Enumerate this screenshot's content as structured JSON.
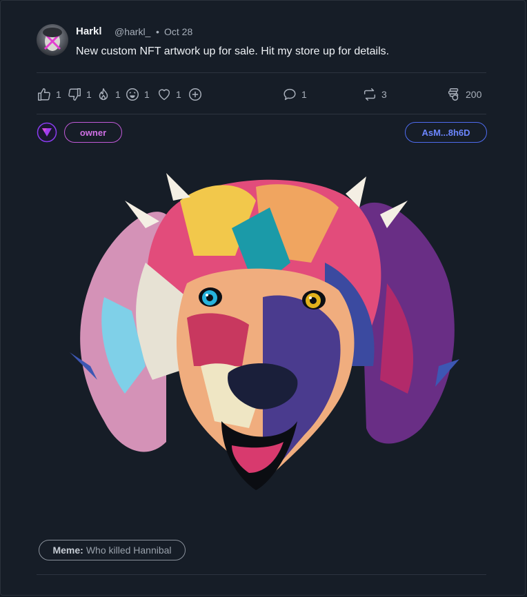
{
  "post": {
    "author_name": "Harkl",
    "author_handle": "@harkl_",
    "separator": "•",
    "date": "Oct 28",
    "text": "New custom NFT artwork up for sale. Hit my store up for details."
  },
  "reactions": [
    {
      "icon": "thumbs-up-icon",
      "count": "1"
    },
    {
      "icon": "thumbs-down-icon",
      "count": "1"
    },
    {
      "icon": "fire-icon",
      "count": "1"
    },
    {
      "icon": "laughing-face-icon",
      "count": "1"
    },
    {
      "icon": "heart-icon",
      "count": "1"
    },
    {
      "icon": "add-reaction-icon",
      "count": ""
    }
  ],
  "stats": {
    "comments": "1",
    "reposts": "3",
    "tips": "200"
  },
  "tags": {
    "owner_label": "owner",
    "address_label": "AsM...8h6D"
  },
  "meme": {
    "prefix": "Meme:",
    "name": "Who killed Hannibal"
  },
  "colors": {
    "background": "#161d27",
    "owner_accent": "#d070e6",
    "address_accent": "#6c86ff",
    "text_muted": "#a7afba"
  }
}
